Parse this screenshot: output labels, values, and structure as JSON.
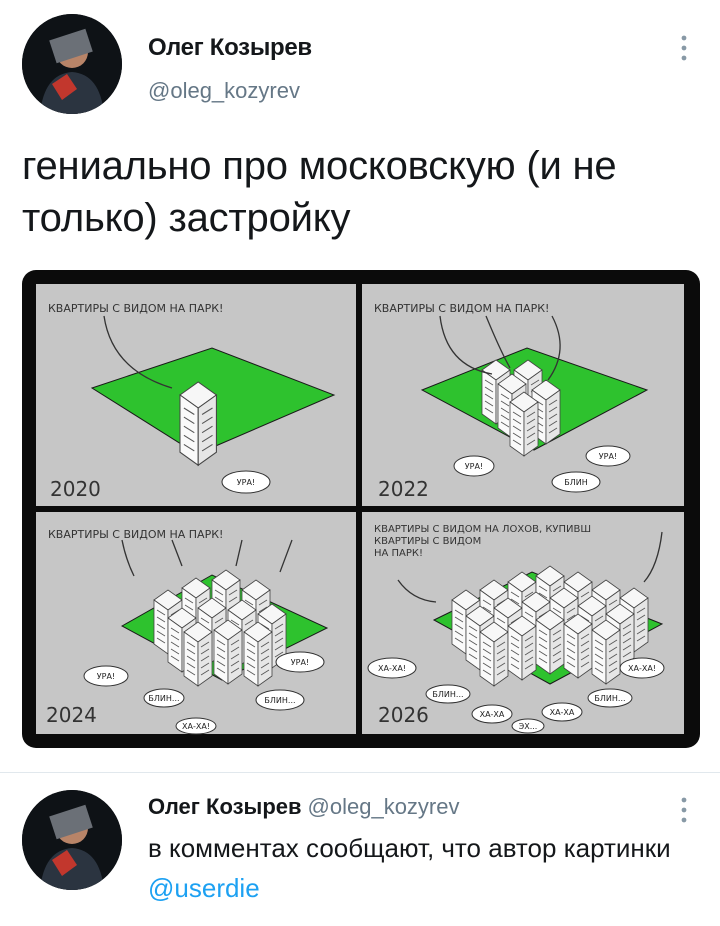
{
  "tweet": {
    "author_name": "Олег Козырев",
    "author_handle": "@oleg_kozyrev",
    "text": "гениально про московскую (и не только) застройку"
  },
  "comic": {
    "panels": [
      {
        "caption": "КВАРТИРЫ С ВИДОМ НА ПАРК!",
        "year": "2020",
        "bubbles": [
          "УРА!"
        ]
      },
      {
        "caption": "КВАРТИРЫ С ВИДОМ НА ПАРК!",
        "year": "2022",
        "bubbles": [
          "УРА!",
          "УРА!",
          "БЛИН"
        ]
      },
      {
        "caption": "КВАРТИРЫ С ВИДОМ НА ПАРК!",
        "year": "2024",
        "bubbles": [
          "УРА!",
          "УРА!",
          "БЛИН...",
          "БЛИН...",
          "ХА-ХА!"
        ]
      },
      {
        "caption_lines": [
          "КВАРТИРЫ С ВИДОМ НА ЛОХОВ, КУПИВШ",
          "КВАРТИРЫ С ВИДОМ",
          "НА ПАРК!"
        ],
        "year": "2026",
        "bubbles": [
          "ХА-ХА!",
          "ХА-ХА!",
          "БЛИН...",
          "БЛИН...",
          "ХА-ХА",
          "ХА-ХА",
          "ЭХ..."
        ]
      }
    ],
    "colors": {
      "ground": "#2ec22e",
      "background": "#c6c6c6",
      "frame": "#0b0b0b"
    }
  },
  "reply": {
    "author_name": "Олег Козырев",
    "author_handle": "@oleg_kozyrev",
    "text_before_mention": "в комментах сообщают, что автор картинки ",
    "mention": "@userdie"
  },
  "icons": {
    "more": "more-vertical-icon"
  }
}
